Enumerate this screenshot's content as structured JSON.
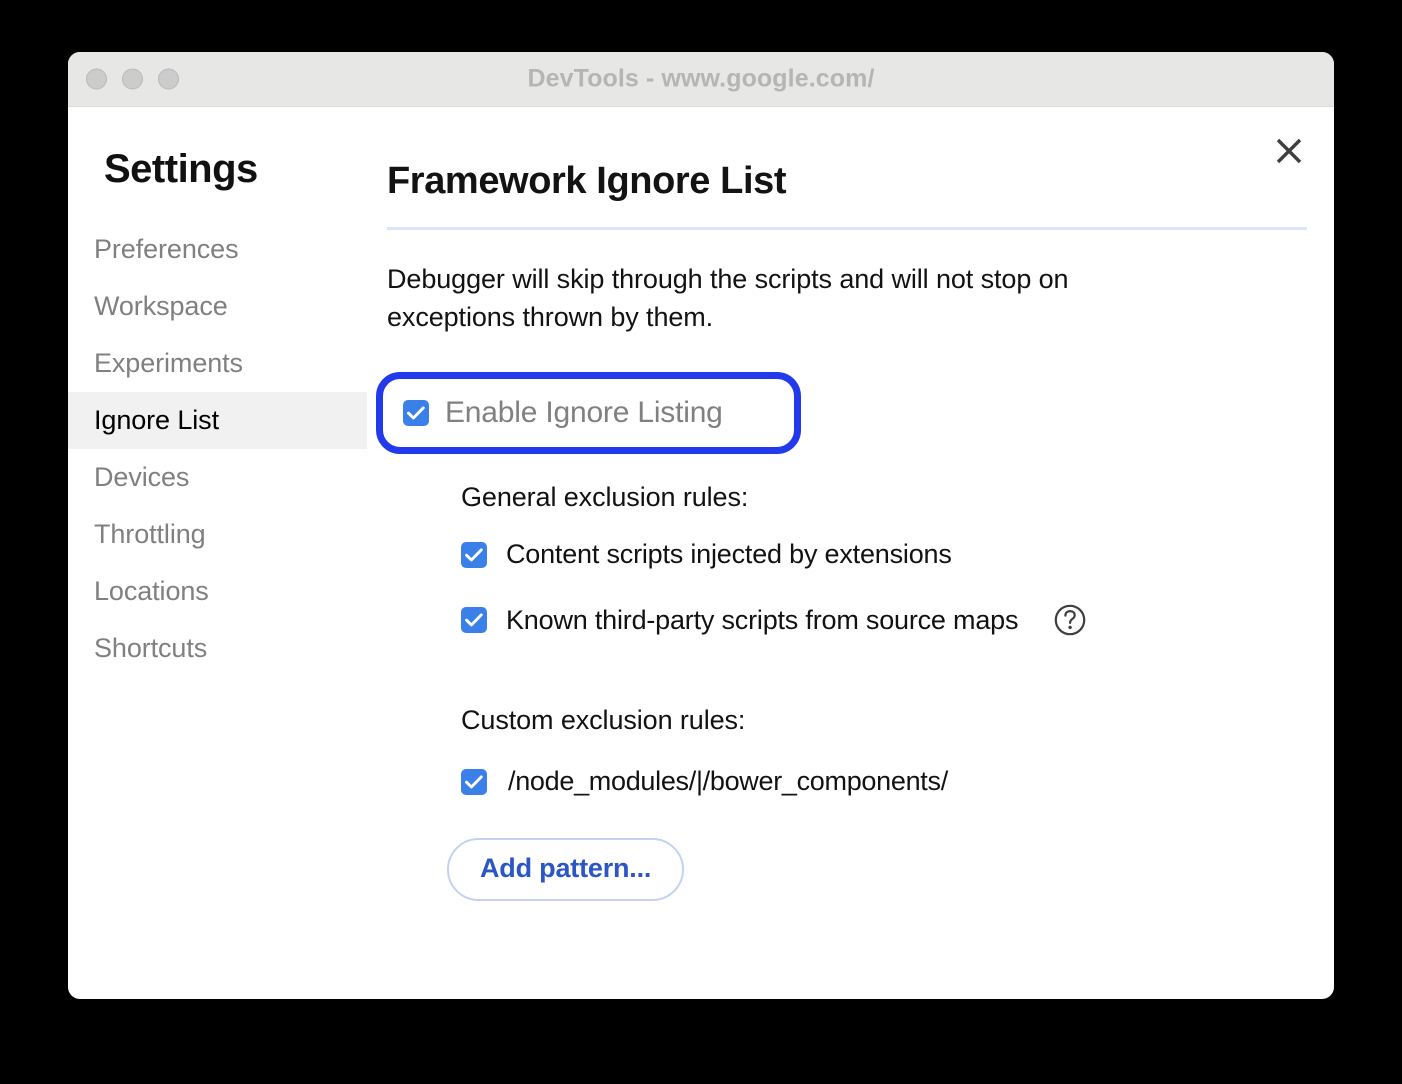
{
  "window": {
    "title": "DevTools - www.google.com/",
    "traffic_lights": [
      "close",
      "minimize",
      "maximize"
    ]
  },
  "sidebar": {
    "heading": "Settings",
    "items": [
      {
        "label": "Preferences",
        "selected": false
      },
      {
        "label": "Workspace",
        "selected": false
      },
      {
        "label": "Experiments",
        "selected": false
      },
      {
        "label": "Ignore List",
        "selected": true
      },
      {
        "label": "Devices",
        "selected": false
      },
      {
        "label": "Throttling",
        "selected": false
      },
      {
        "label": "Locations",
        "selected": false
      },
      {
        "label": "Shortcuts",
        "selected": false
      }
    ]
  },
  "main": {
    "title": "Framework Ignore List",
    "description": "Debugger will skip through the scripts and will not stop on exceptions thrown by them.",
    "close_icon": "close-icon",
    "enable": {
      "label": "Enable Ignore Listing",
      "checked": true,
      "highlighted": true
    },
    "general": {
      "label": "General exclusion rules:",
      "rules": [
        {
          "label": "Content scripts injected by extensions",
          "checked": true
        },
        {
          "label": "Known third-party scripts from source maps",
          "checked": true,
          "help_icon": "help-icon"
        }
      ]
    },
    "custom": {
      "label": "Custom exclusion rules:",
      "rules": [
        {
          "label": "/node_modules/|/bower_components/",
          "checked": true
        }
      ],
      "add_button_label": "Add pattern..."
    }
  },
  "colors": {
    "annotation_blue": "#2239ec",
    "checkbox_blue": "#3b7fe8",
    "link_blue": "#2a56c6",
    "divider": "#dde3f8",
    "selected_row_bg": "#f1f1f1",
    "titlebar_bg": "#e7e7e5",
    "muted_text": "#808080"
  }
}
